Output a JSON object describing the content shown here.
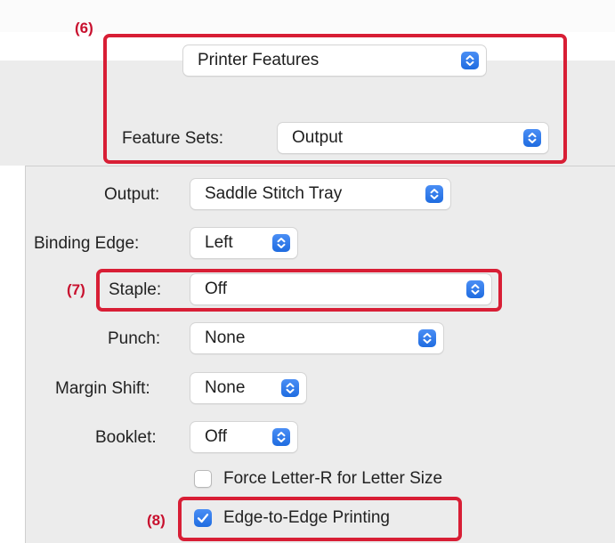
{
  "colors": {
    "accent": "#1f6ce0",
    "annotation": "#d81e35",
    "panel_bg": "#ececec"
  },
  "annotations": {
    "step6": "(6)",
    "step7": "(7)",
    "step8": "(8)"
  },
  "panel_menu": {
    "value": "Printer Features"
  },
  "feature_sets": {
    "label": "Feature Sets:",
    "value": "Output"
  },
  "settings": {
    "output": {
      "label": "Output:",
      "value": "Saddle Stitch Tray"
    },
    "binding_edge": {
      "label": "Binding Edge:",
      "value": "Left"
    },
    "staple": {
      "label": "Staple:",
      "value": "Off"
    },
    "punch": {
      "label": "Punch:",
      "value": "None"
    },
    "margin_shift": {
      "label": "Margin Shift:",
      "value": "None"
    },
    "booklet": {
      "label": "Booklet:",
      "value": "Off"
    }
  },
  "checkboxes": {
    "force_letter_r": {
      "label": "Force Letter-R for Letter Size",
      "checked": false
    },
    "edge_to_edge": {
      "label": "Edge-to-Edge Printing",
      "checked": true
    }
  },
  "icons": {
    "popup_chevron": "chevron-up-down-icon",
    "checkmark": "checkmark-icon"
  }
}
